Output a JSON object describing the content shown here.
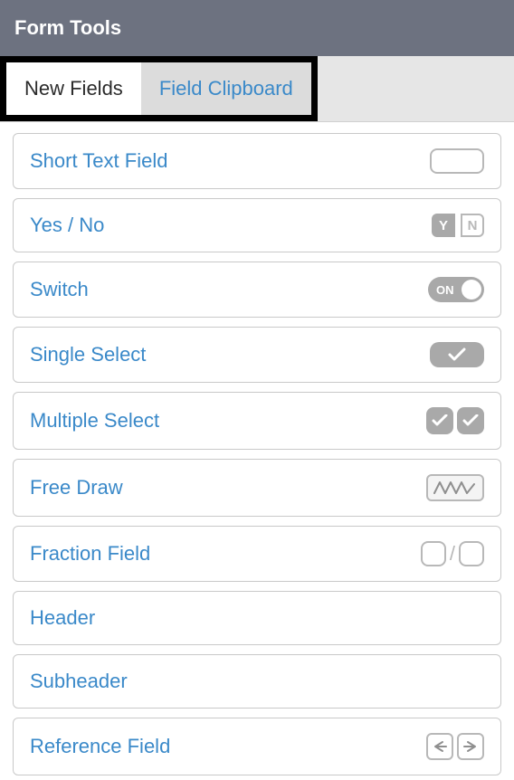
{
  "header": {
    "title": "Form Tools"
  },
  "tabs": [
    {
      "label": "New Fields",
      "active": true
    },
    {
      "label": "Field Clipboard",
      "active": false
    }
  ],
  "fields": [
    {
      "label": "Short Text Field",
      "icon": "textbox"
    },
    {
      "label": "Yes / No",
      "icon": "yesno"
    },
    {
      "label": "Switch",
      "icon": "switch",
      "switch_text": "ON"
    },
    {
      "label": "Single Select",
      "icon": "single-select"
    },
    {
      "label": "Multiple Select",
      "icon": "multi-select"
    },
    {
      "label": "Free Draw",
      "icon": "freedraw"
    },
    {
      "label": "Fraction Field",
      "icon": "fraction"
    },
    {
      "label": "Header",
      "icon": ""
    },
    {
      "label": "Subheader",
      "icon": ""
    },
    {
      "label": "Reference Field",
      "icon": "reference"
    }
  ],
  "yn": {
    "y": "Y",
    "n": "N"
  }
}
